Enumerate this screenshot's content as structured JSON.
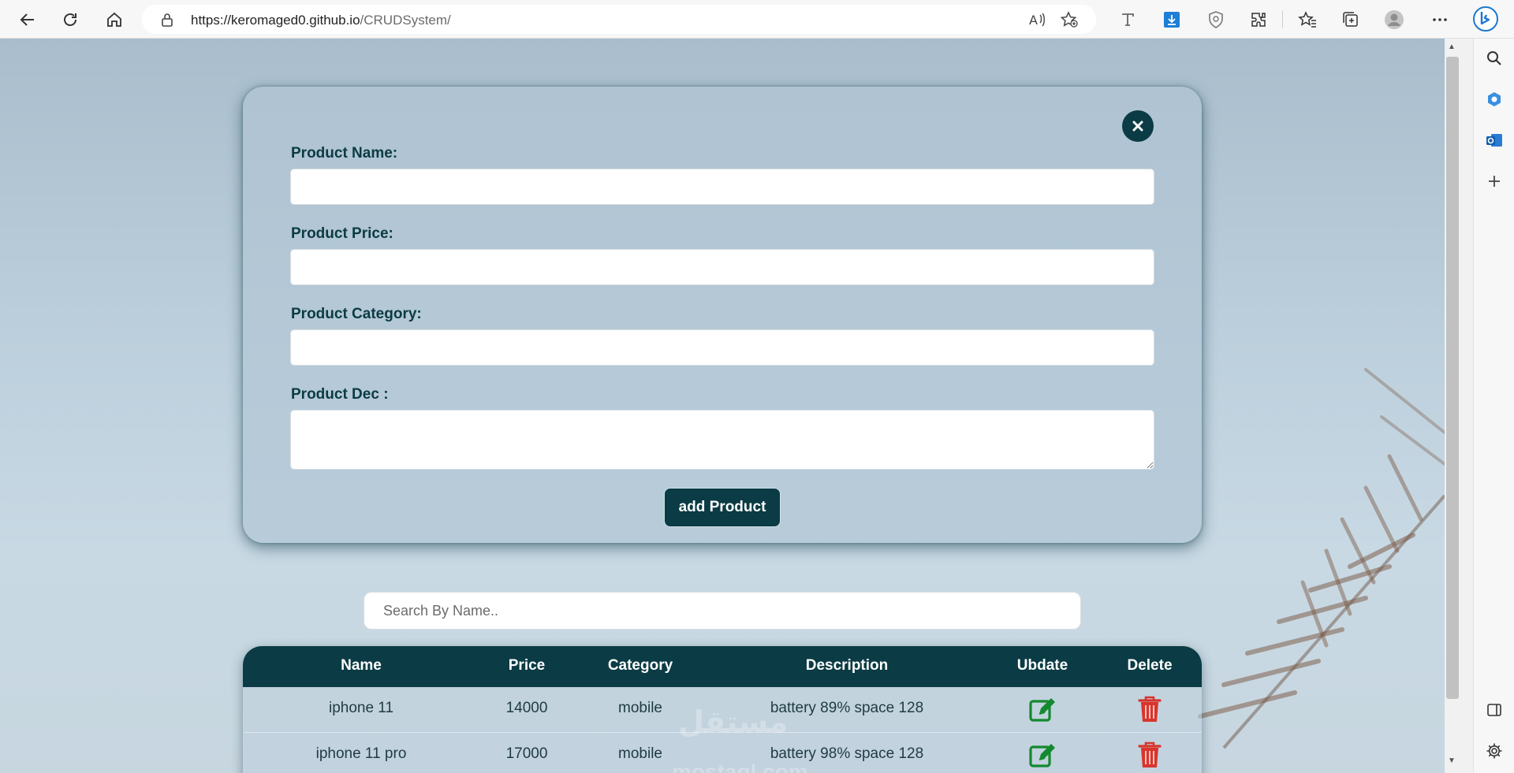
{
  "browser": {
    "url_host": "https://keromaged0.github.io",
    "url_path": "/CRUDSystem/"
  },
  "form": {
    "name_label": "Product Name:",
    "price_label": "Product Price:",
    "category_label": "Product Category:",
    "desc_label": "Product Dec :",
    "name_value": "",
    "price_value": "",
    "category_value": "",
    "desc_value": "",
    "add_label": "add Product"
  },
  "search": {
    "placeholder": "Search By Name.."
  },
  "table": {
    "headers": [
      "Name",
      "Price",
      "Category",
      "Description",
      "Ubdate",
      "Delete"
    ],
    "rows": [
      {
        "name": "iphone 11",
        "price": "14000",
        "category": "mobile",
        "description": "battery 89% space 128"
      },
      {
        "name": "iphone 11 pro",
        "price": "17000",
        "category": "mobile",
        "description": "battery 98% space 128"
      }
    ]
  },
  "watermark": {
    "arabic": "مستقل",
    "latin": "mostaql.com"
  },
  "colors": {
    "accent": "#0b3b44",
    "update_icon": "#14892f",
    "delete_icon": "#d9342b"
  },
  "icons": {
    "back": "back-arrow-icon",
    "refresh": "refresh-icon",
    "home": "home-icon",
    "close": "close-icon",
    "update": "edit-icon",
    "delete": "trash-icon"
  }
}
